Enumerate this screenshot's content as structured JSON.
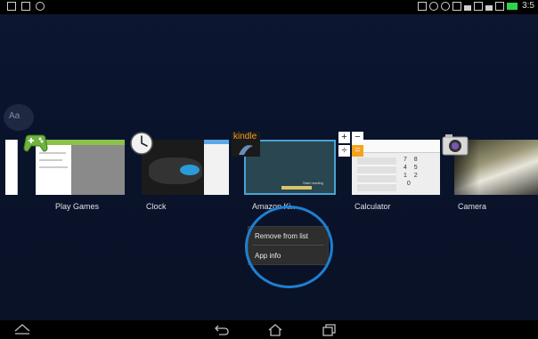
{
  "apps": [
    {
      "label": "Play Games"
    },
    {
      "label": "Clock"
    },
    {
      "label": "Amazon Ki.."
    },
    {
      "label": "Calculator"
    },
    {
      "label": "Camera"
    }
  ],
  "kindle_badge": "kindle",
  "kindle_thumb_text": "Start reading",
  "calculator_keys": [
    "7",
    "8",
    "4",
    "5",
    "1",
    "2",
    "0"
  ],
  "calculator_op_keys": [
    "+",
    "−",
    "÷",
    "="
  ],
  "context_menu": {
    "items": [
      "Remove from list",
      "App info"
    ]
  },
  "highlight_color": "#1f7fd0",
  "status": {
    "time": "3:5"
  }
}
